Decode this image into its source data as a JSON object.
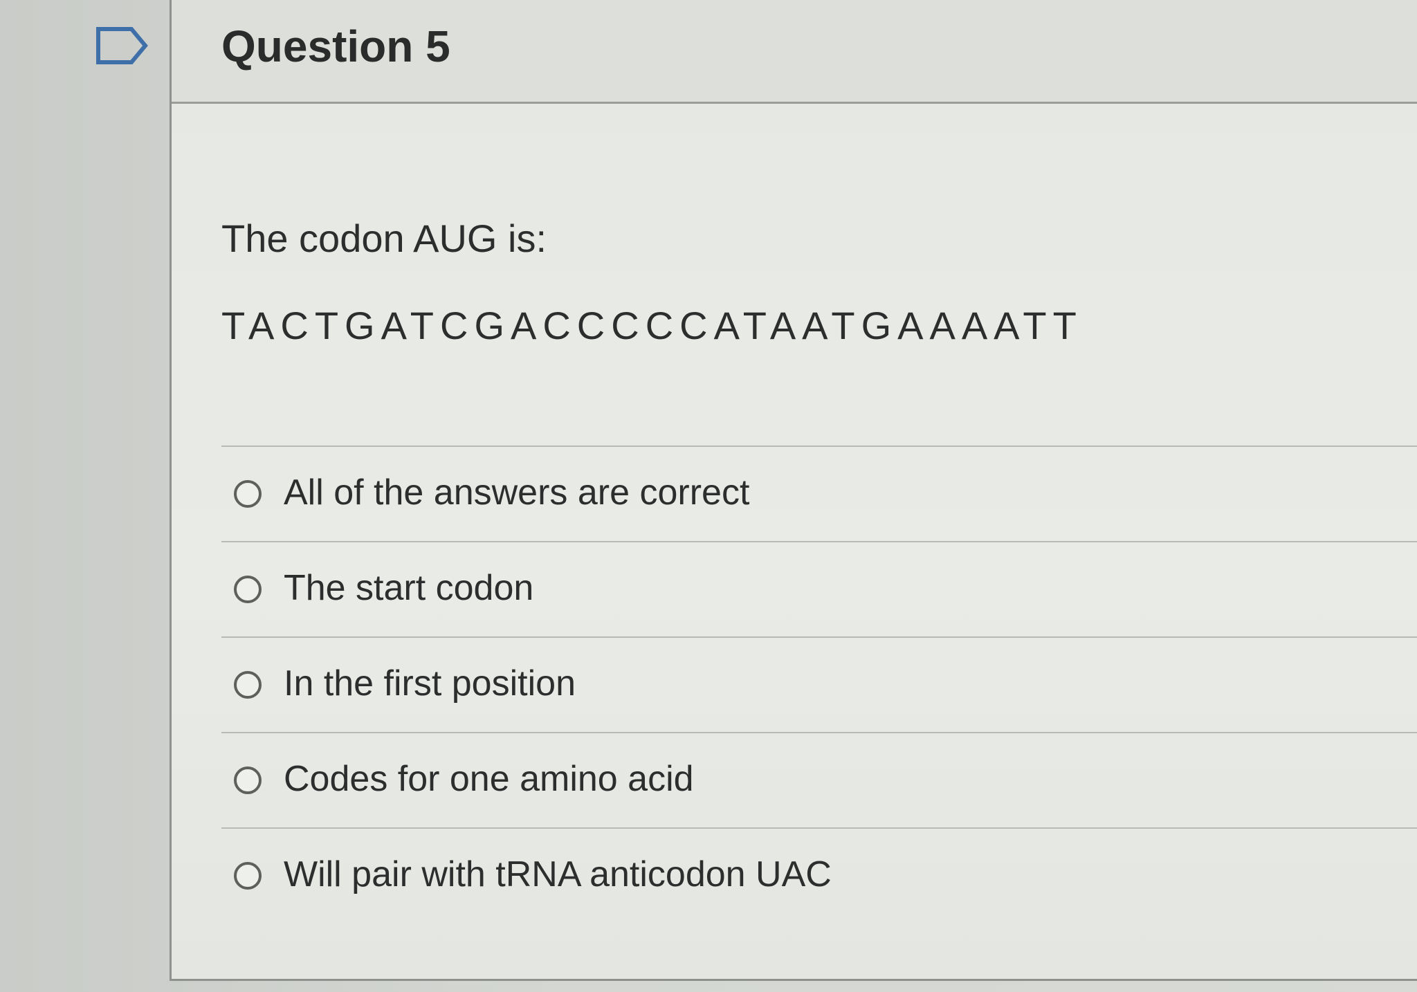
{
  "question": {
    "title": "Question 5",
    "prompt": "The codon AUG is:",
    "sequence": "TACTGATCGACCCCCATAATGAAAATT",
    "answers": [
      {
        "label": "All of the answers are correct",
        "selected": false
      },
      {
        "label": "The start codon",
        "selected": false
      },
      {
        "label": "In the first position",
        "selected": false
      },
      {
        "label": "Codes for one amino acid",
        "selected": false
      },
      {
        "label": "Will pair with tRNA anticodon UAC",
        "selected": false
      }
    ]
  },
  "icons": {
    "flag": "flag-question-icon",
    "radio": "radio-button-icon"
  },
  "colors": {
    "text": "#2c2d2d",
    "border": "#8e918d",
    "background": "#e6e8e4"
  }
}
